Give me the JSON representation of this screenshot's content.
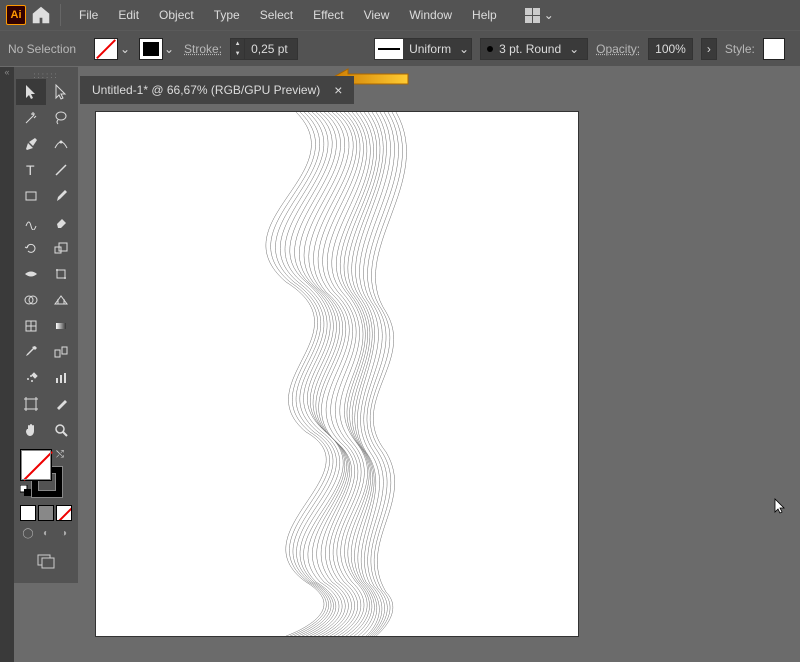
{
  "app": {
    "logo_text": "Ai"
  },
  "menu": {
    "file": "File",
    "edit": "Edit",
    "object": "Object",
    "type": "Type",
    "select": "Select",
    "effect": "Effect",
    "view": "View",
    "window": "Window",
    "help": "Help"
  },
  "controlbar": {
    "selection": "No Selection",
    "stroke_label": "Stroke:",
    "stroke_value": "0,25 pt",
    "profile": "Uniform",
    "brush": "3 pt. Round",
    "opacity_label": "Opacity:",
    "opacity_value": "100%",
    "style_label": "Style:"
  },
  "document": {
    "tab": "Untitled-1* @ 66,67% (RGB/GPU Preview)"
  },
  "tools": {
    "selection": "selection-tool",
    "direct": "direct-selection-tool",
    "wand": "magic-wand-tool",
    "lasso": "lasso-tool",
    "pen": "pen-tool",
    "curvature": "curvature-tool",
    "type": "type-tool",
    "line": "line-tool",
    "rect": "rectangle-tool",
    "brush": "paintbrush-tool",
    "shaper": "shaper-tool",
    "eraser": "eraser-tool",
    "rotate": "rotate-tool",
    "scale": "scale-tool",
    "width": "width-tool",
    "free": "free-transform-tool",
    "shapebuilder": "shape-builder-tool",
    "perspective": "perspective-grid-tool",
    "mesh": "mesh-tool",
    "gradient": "gradient-tool",
    "eyedrop": "eyedropper-tool",
    "blend": "blend-tool",
    "symbol": "symbol-sprayer-tool",
    "graph": "column-graph-tool",
    "artboard": "artboard-tool",
    "slice": "slice-tool",
    "hand": "hand-tool",
    "zoom": "zoom-tool"
  }
}
